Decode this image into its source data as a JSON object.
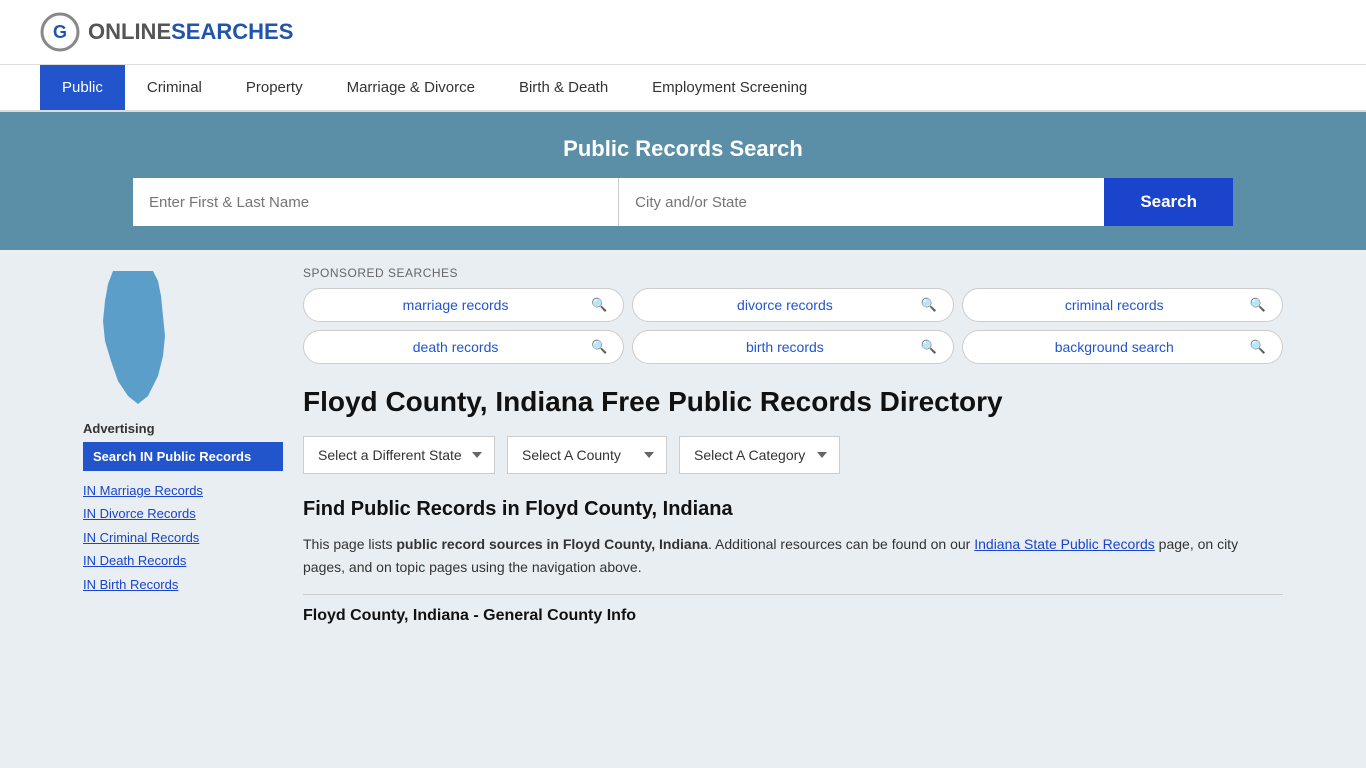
{
  "site": {
    "logo_text_online": "ONLINE",
    "logo_text_searches": "SEARCHES"
  },
  "nav": {
    "items": [
      {
        "label": "Public",
        "active": true
      },
      {
        "label": "Criminal",
        "active": false
      },
      {
        "label": "Property",
        "active": false
      },
      {
        "label": "Marriage & Divorce",
        "active": false
      },
      {
        "label": "Birth & Death",
        "active": false
      },
      {
        "label": "Employment Screening",
        "active": false
      }
    ]
  },
  "search_banner": {
    "title": "Public Records Search",
    "name_placeholder": "Enter First & Last Name",
    "location_placeholder": "City and/or State",
    "button_label": "Search"
  },
  "sponsored": {
    "label": "SPONSORED SEARCHES",
    "items": [
      {
        "label": "marriage records"
      },
      {
        "label": "divorce records"
      },
      {
        "label": "criminal records"
      },
      {
        "label": "death records"
      },
      {
        "label": "birth records"
      },
      {
        "label": "background search"
      }
    ]
  },
  "page": {
    "title": "Floyd County, Indiana Free Public Records Directory",
    "dropdowns": {
      "state": "Select a Different State",
      "county": "Select A County",
      "category": "Select A Category"
    },
    "find_heading": "Find Public Records in Floyd County, Indiana",
    "body_text_1": "This page lists ",
    "body_text_bold": "public record sources in Floyd County, Indiana",
    "body_text_2": ". Additional resources can be found on our ",
    "body_text_link": "Indiana State Public Records",
    "body_text_3": " page, on city pages, and on topic pages using the navigation above.",
    "bottom_heading": "Floyd County, Indiana - General County Info"
  },
  "sidebar": {
    "advertising_label": "Advertising",
    "ad_button_label": "Search IN Public Records",
    "links": [
      {
        "label": "IN Marriage Records"
      },
      {
        "label": "IN Divorce Records"
      },
      {
        "label": "IN Criminal Records"
      },
      {
        "label": "IN Death Records"
      },
      {
        "label": "IN Birth Records"
      }
    ]
  }
}
